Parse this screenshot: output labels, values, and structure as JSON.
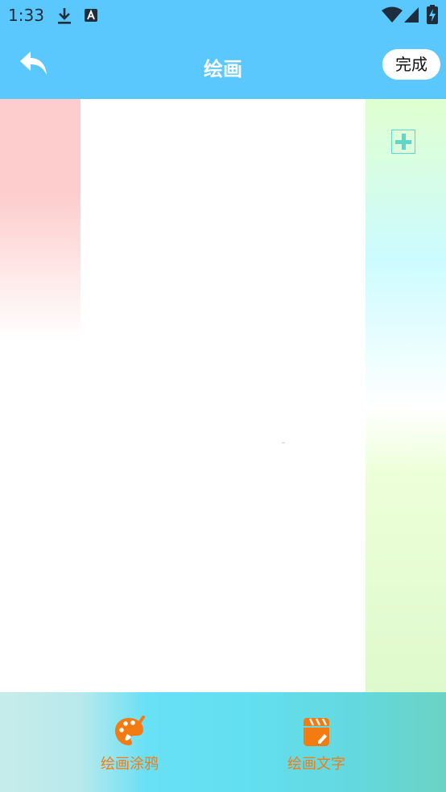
{
  "status_bar": {
    "time": "1:33",
    "icons": [
      "download-icon",
      "a-letter-icon",
      "wifi-icon",
      "cell-signal-icon",
      "battery-charging-icon"
    ]
  },
  "header": {
    "title": "绘画",
    "done_label": "完成",
    "back_icon": "back-arrow-icon"
  },
  "side_panel": {
    "add_icon": "plus-icon"
  },
  "bottom_nav": {
    "items": [
      {
        "label": "绘画涂鸦",
        "icon": "palette-icon"
      },
      {
        "label": "绘画文字",
        "icon": "clapperboard-edit-icon"
      }
    ]
  },
  "colors": {
    "header_bg": "#5bc8fd",
    "accent_orange": "#f47a12",
    "plus_teal": "#5fd6c6"
  }
}
